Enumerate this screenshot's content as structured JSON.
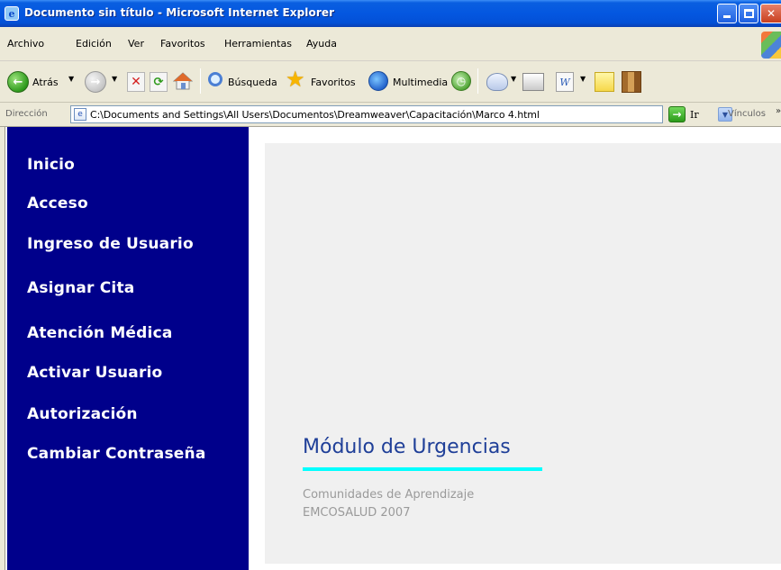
{
  "window": {
    "title": "Documento sin título - Microsoft Internet Explorer"
  },
  "menu": [
    "Archivo",
    "Edición",
    "Ver",
    "Favoritos",
    "Herramientas",
    "Ayuda"
  ],
  "toolbar": {
    "back_label": "Atrás",
    "search_label": "Búsqueda",
    "favorites_label": "Favoritos",
    "media_label": "Multimedia"
  },
  "address": {
    "label": "Dirección",
    "value": "C:\\Documents and Settings\\All Users\\Documentos\\Dreamweaver\\Capacitación\\Marco 4.html",
    "go_label": "Ir",
    "links_label": "Vínculos"
  },
  "nav": {
    "items": [
      "Inicio",
      "Acceso",
      "Ingreso de Usuario",
      "Asignar Cita",
      "Atención Médica",
      "Activar Usuario",
      "Autorización",
      "Cambiar Contraseña"
    ]
  },
  "main": {
    "title": "Módulo de Urgencias",
    "subtitle_line1": "Comunidades de Aprendizaje",
    "subtitle_line2": "EMCOSALUD 2007"
  },
  "colors": {
    "nav_background": "#00008b",
    "title_color": "#1f3f98",
    "accent_rule": "#00ffff",
    "main_background": "#f0f0f0"
  }
}
